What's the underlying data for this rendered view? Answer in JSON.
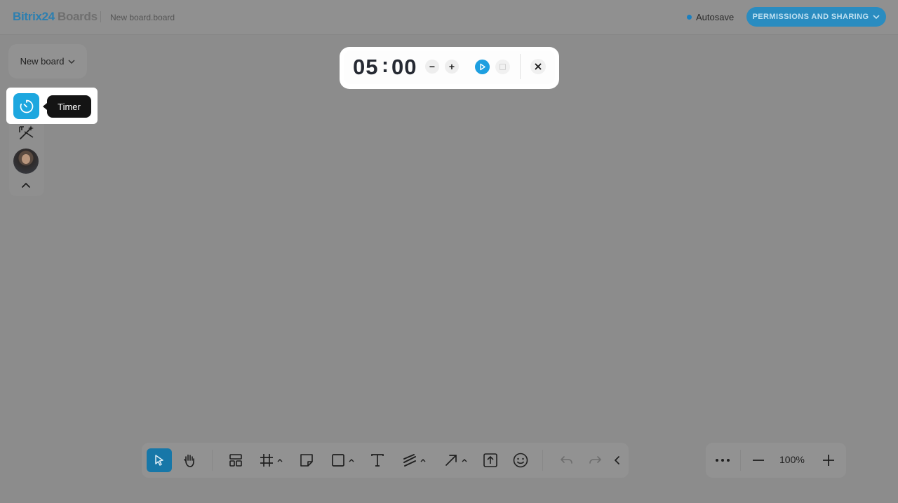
{
  "header": {
    "logo_main": "Bitrix24",
    "logo_sub": "Boards",
    "board_filename": "New board.board",
    "autosave_label": "Autosave",
    "permissions_button": "PERMISSIONS AND SHARING"
  },
  "board_selector": {
    "label": "New board"
  },
  "left_tools": {
    "timer_tooltip": "Timer"
  },
  "timer": {
    "minutes": "05",
    "separator": ":",
    "seconds": "00",
    "decrement_symbol": "−",
    "increment_symbol": "+"
  },
  "zoom": {
    "value": "100%"
  },
  "colors": {
    "accent": "#1da7df",
    "brand": "#2d7fb0",
    "active_tool": "#1777a8",
    "overlay": "#8c8c8c"
  },
  "icons": {
    "toolbar": [
      "select-icon",
      "hand-icon",
      "templates-icon",
      "frame-icon",
      "sticky-note-icon",
      "shape-icon",
      "text-icon",
      "pen-icon",
      "arrow-icon",
      "upload-icon",
      "emoji-icon",
      "undo-icon",
      "redo-icon",
      "collapse-left-icon"
    ],
    "zoom": [
      "more-icon",
      "zoom-out-icon",
      "zoom-in-icon"
    ]
  }
}
